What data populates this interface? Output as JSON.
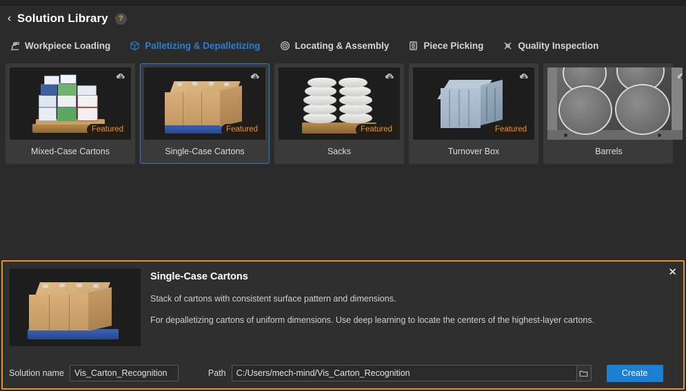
{
  "header": {
    "back_icon": "chevron-left-icon",
    "title": "Solution Library",
    "help_icon": "?"
  },
  "tabs": [
    {
      "label": "Workpiece Loading",
      "icon": "robot-arm-icon",
      "active": false
    },
    {
      "label": "Palletizing & Depalletizing",
      "icon": "box-3d-icon",
      "active": true
    },
    {
      "label": "Locating & Assembly",
      "icon": "gear-target-icon",
      "active": false
    },
    {
      "label": "Piece Picking",
      "icon": "bin-icon",
      "active": false
    },
    {
      "label": "Quality Inspection",
      "icon": "inspection-icon",
      "active": false
    }
  ],
  "cards": [
    {
      "label": "Mixed-Case Cartons",
      "badge": "Featured",
      "download_icon": "download-cloud-icon",
      "selected": false
    },
    {
      "label": "Single-Case Cartons",
      "badge": "Featured",
      "download_icon": "download-cloud-icon",
      "selected": true
    },
    {
      "label": "Sacks",
      "badge": "Featured",
      "download_icon": "download-cloud-icon",
      "selected": false
    },
    {
      "label": "Turnover Box",
      "badge": "Featured",
      "download_icon": "download-cloud-icon",
      "selected": false
    },
    {
      "label": "Barrels",
      "badge": "",
      "download_icon": "download-cloud-icon",
      "selected": false
    }
  ],
  "detail": {
    "title": "Single-Case Cartons",
    "description_1": "Stack of cartons with consistent surface pattern and dimensions.",
    "description_2": "For depalletizing cartons of uniform dimensions. Use deep learning to locate the centers of the highest-layer cartons.",
    "close_icon": "✕"
  },
  "form": {
    "name_label": "Solution name",
    "name_value": "Vis_Carton_Recognition",
    "path_label": "Path",
    "path_value": "C:/Users/mech-mind/Vis_Carton_Recognition",
    "browse_icon": "folder-icon",
    "create_label": "Create"
  },
  "colors": {
    "accent_blue": "#2a7fd4",
    "accent_orange": "#e8922f",
    "badge_text": "#e8912f",
    "background": "#2b2b2b",
    "card_background": "#3a3a3a"
  }
}
